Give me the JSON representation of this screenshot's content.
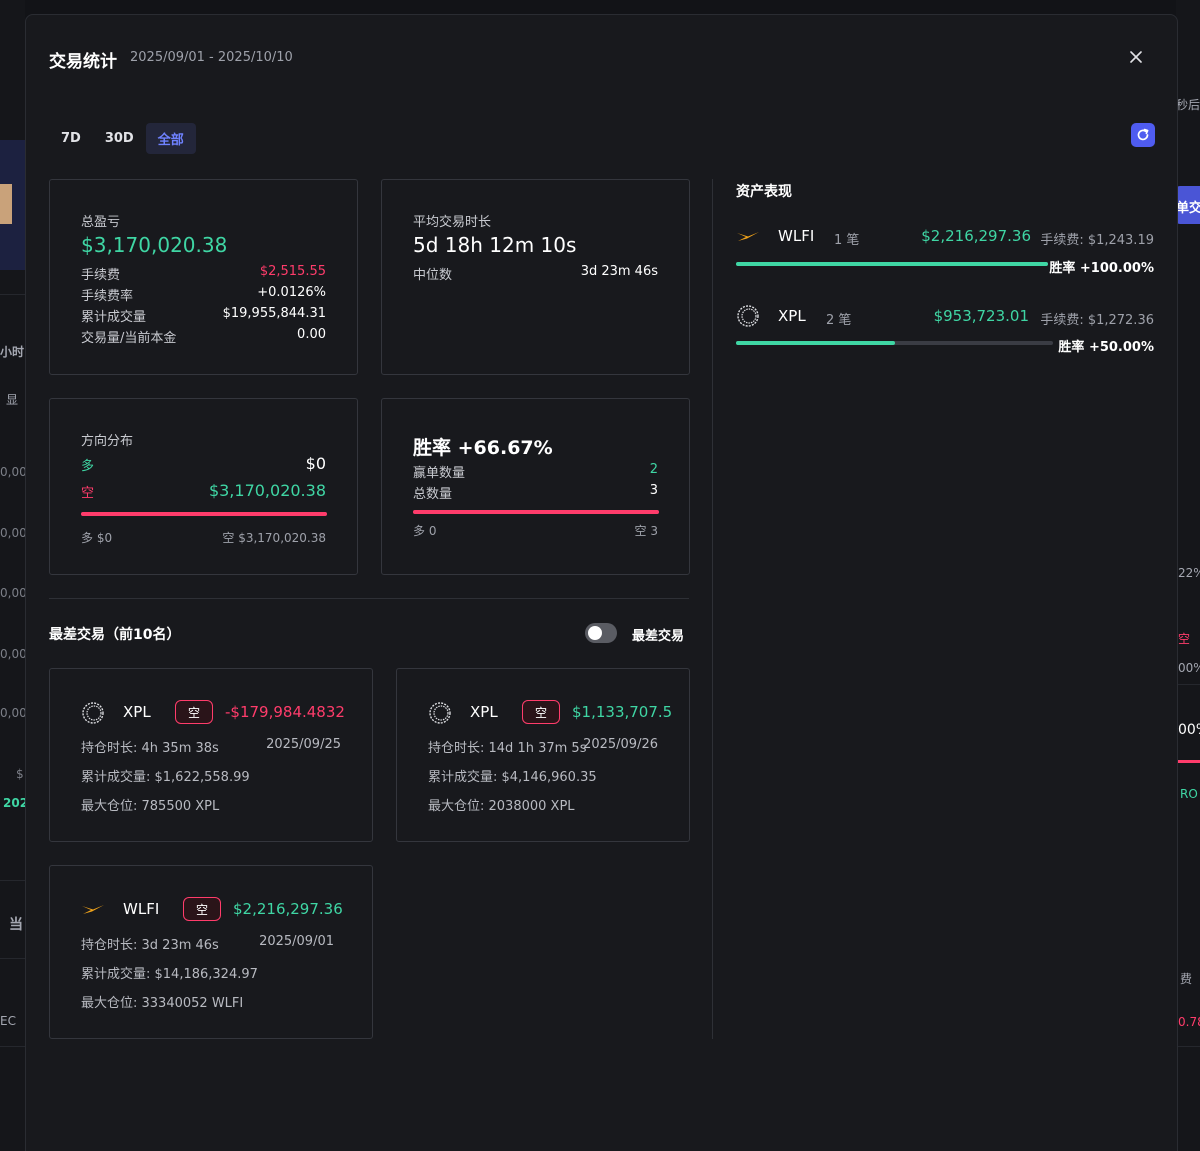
{
  "background": {
    "right_labels": [
      "秒后",
      "单交",
      "22%",
      "空",
      "00%",
      "00%",
      "RO",
      "费",
      "0.78"
    ],
    "left_labels": [
      "小时",
      "显",
      "0,00",
      "0,00",
      "0,00",
      "0,00",
      "0,00",
      "$",
      "202",
      "当",
      "EC"
    ]
  },
  "modal": {
    "title": "交易统计",
    "date_range": "2025/09/01 - 2025/10/10",
    "tabs": [
      {
        "label": "7D",
        "active": false
      },
      {
        "label": "30D",
        "active": false
      },
      {
        "label": "全部",
        "active": true
      }
    ]
  },
  "summary": {
    "pnl_label": "总盈亏",
    "pnl_value": "$3,170,020.38",
    "fee_label": "手续费",
    "fee_value": "$2,515.55",
    "fee_rate_label": "手续费率",
    "fee_rate_value": "+0.0126%",
    "volume_label": "累计成交量",
    "volume_value": "$19,955,844.31",
    "vol_ratio_label": "交易量/当前本金",
    "vol_ratio_value": "0.00"
  },
  "duration": {
    "label": "平均交易时长",
    "value": "5d 18h 12m 10s",
    "median_label": "中位数",
    "median_value": "3d 23m 46s"
  },
  "direction": {
    "label": "方向分布",
    "long_label": "多",
    "long_value": "$0",
    "short_label": "空",
    "short_value": "$3,170,020.38",
    "short_fraction": 1.0,
    "foot_long": "多 $0",
    "foot_short": "空 $3,170,020.38"
  },
  "winrate": {
    "title": "胜率 +66.67%",
    "wins_label": "赢单数量",
    "wins_value": "2",
    "total_label": "总数量",
    "total_value": "3",
    "short_fraction": 1.0,
    "foot_long": "多 0",
    "foot_short": "空 3"
  },
  "worst": {
    "title": "最差交易（前10名）",
    "toggle_label": "最差交易",
    "toggle_on": false,
    "trades": [
      {
        "symbol": "XPL",
        "side": "空",
        "pnl": "-$179,984.4832",
        "pnl_sign": "neg",
        "hold": "持仓时长: 4h 35m 38s",
        "date": "2025/09/25",
        "volume": "累计成交量: $1,622,558.99",
        "max_pos": "最大仓位: 785500 XPL",
        "icon": "xpl-icon"
      },
      {
        "symbol": "XPL",
        "side": "空",
        "pnl": "$1,133,707.5",
        "pnl_sign": "pos",
        "hold": "持仓时长: 14d 1h 37m 5s",
        "date": "2025/09/26",
        "volume": "累计成交量: $4,146,960.35",
        "max_pos": "最大仓位: 2038000 XPL",
        "icon": "xpl-icon"
      },
      {
        "symbol": "WLFI",
        "side": "空",
        "pnl": "$2,216,297.36",
        "pnl_sign": "pos",
        "hold": "持仓时长: 3d 23m 46s",
        "date": "2025/09/01",
        "volume": "累计成交量: $14,186,324.97",
        "max_pos": "最大仓位: 33340052 WLFI",
        "icon": "wlfi-icon"
      }
    ]
  },
  "assets": {
    "title": "资产表现",
    "items": [
      {
        "symbol": "WLFI",
        "count": "1 笔",
        "pnl": "$2,216,297.36",
        "fee": "手续费: $1,243.19",
        "winrate": "胜率 +100.00%",
        "win_fraction": 1.0,
        "icon": "wlfi-icon"
      },
      {
        "symbol": "XPL",
        "count": "2 笔",
        "pnl": "$953,723.01",
        "fee": "手续费: $1,272.36",
        "winrate": "胜率 +50.00%",
        "win_fraction": 0.5,
        "icon": "xpl-icon"
      }
    ]
  },
  "colors": {
    "green": "#3fd6a4",
    "red": "#ff3c6b",
    "accent": "#4f5cf0"
  }
}
